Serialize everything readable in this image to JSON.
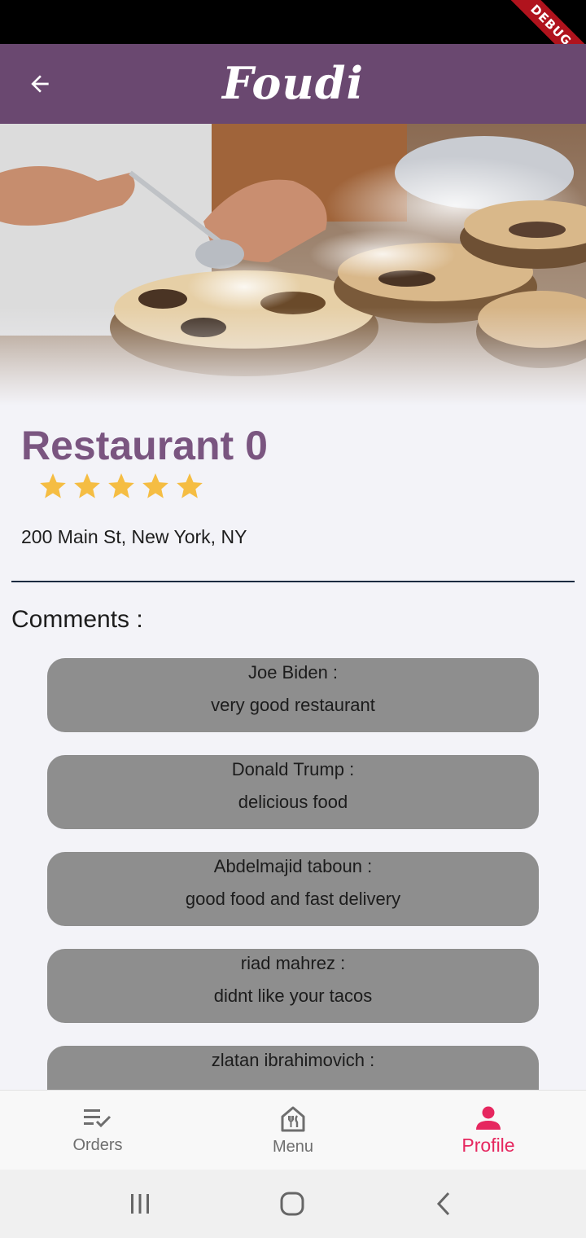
{
  "status_bar": {
    "debug_label": "DEBUG"
  },
  "app_bar": {
    "title": "Foudi",
    "back_icon": "arrow-left-icon"
  },
  "restaurant": {
    "name": "Restaurant 0",
    "rating": 5,
    "address": "200 Main St, New York, NY"
  },
  "comments": {
    "heading": "Comments :",
    "items": [
      {
        "author": "Joe Biden :",
        "text": "very good restaurant"
      },
      {
        "author": "Donald Trump :",
        "text": "delicious food"
      },
      {
        "author": "Abdelmajid taboun :",
        "text": "good food and fast delivery"
      },
      {
        "author": "riad mahrez :",
        "text": "didnt like your tacos"
      },
      {
        "author": "zlatan ibrahimovich :",
        "text": ""
      }
    ]
  },
  "bottom_nav": {
    "items": [
      {
        "label": "Orders",
        "icon": "checklist-icon",
        "active": false
      },
      {
        "label": "Menu",
        "icon": "restaurant-icon",
        "active": false
      },
      {
        "label": "Profile",
        "icon": "person-icon",
        "active": true
      }
    ]
  },
  "colors": {
    "app_bar": "#6a4870",
    "accent_title": "#7a5580",
    "star": "#f5bd43",
    "active_nav": "#e6275f",
    "comment_bg": "#8e8e8e"
  }
}
